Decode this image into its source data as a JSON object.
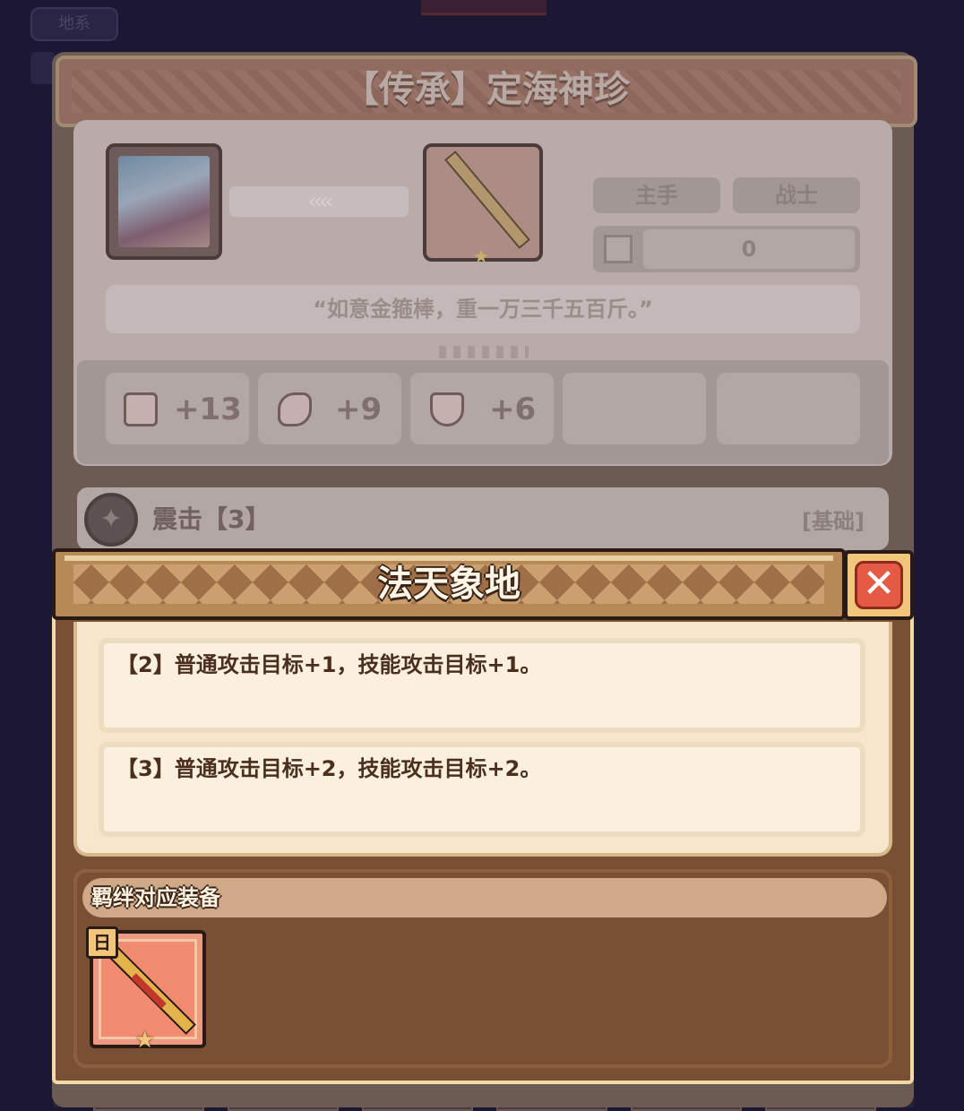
{
  "background": {
    "top_tag": "地系"
  },
  "equipment": {
    "title": "【传承】定海神珍",
    "slot_label": "主手",
    "class_label": "战士",
    "power_value": "0",
    "quote": "“如意金箍棒，重一万三千五百斤。”",
    "stats": [
      {
        "icon": "attack-icon",
        "value": "+13"
      },
      {
        "icon": "wing-icon",
        "value": "+9"
      },
      {
        "icon": "shield-icon",
        "value": "+6"
      }
    ],
    "skill": {
      "name": "震击【3】",
      "tag": "[基础]"
    }
  },
  "popup": {
    "title": "法天象地",
    "close_icon": "close-icon",
    "effects": [
      "【2】普通攻击目标+1，技能攻击目标+1。",
      "【3】普通攻击目标+2，技能攻击目标+2。"
    ],
    "bond_label": "羁绊对应装备",
    "bond_item": {
      "badge": "日",
      "icon": "golden-staff-icon"
    }
  },
  "colors": {
    "popup_bg": "#7a5035",
    "popup_border": "#f3d8a8",
    "close_red": "#e45a44",
    "effect_text": "#4a2f21"
  }
}
